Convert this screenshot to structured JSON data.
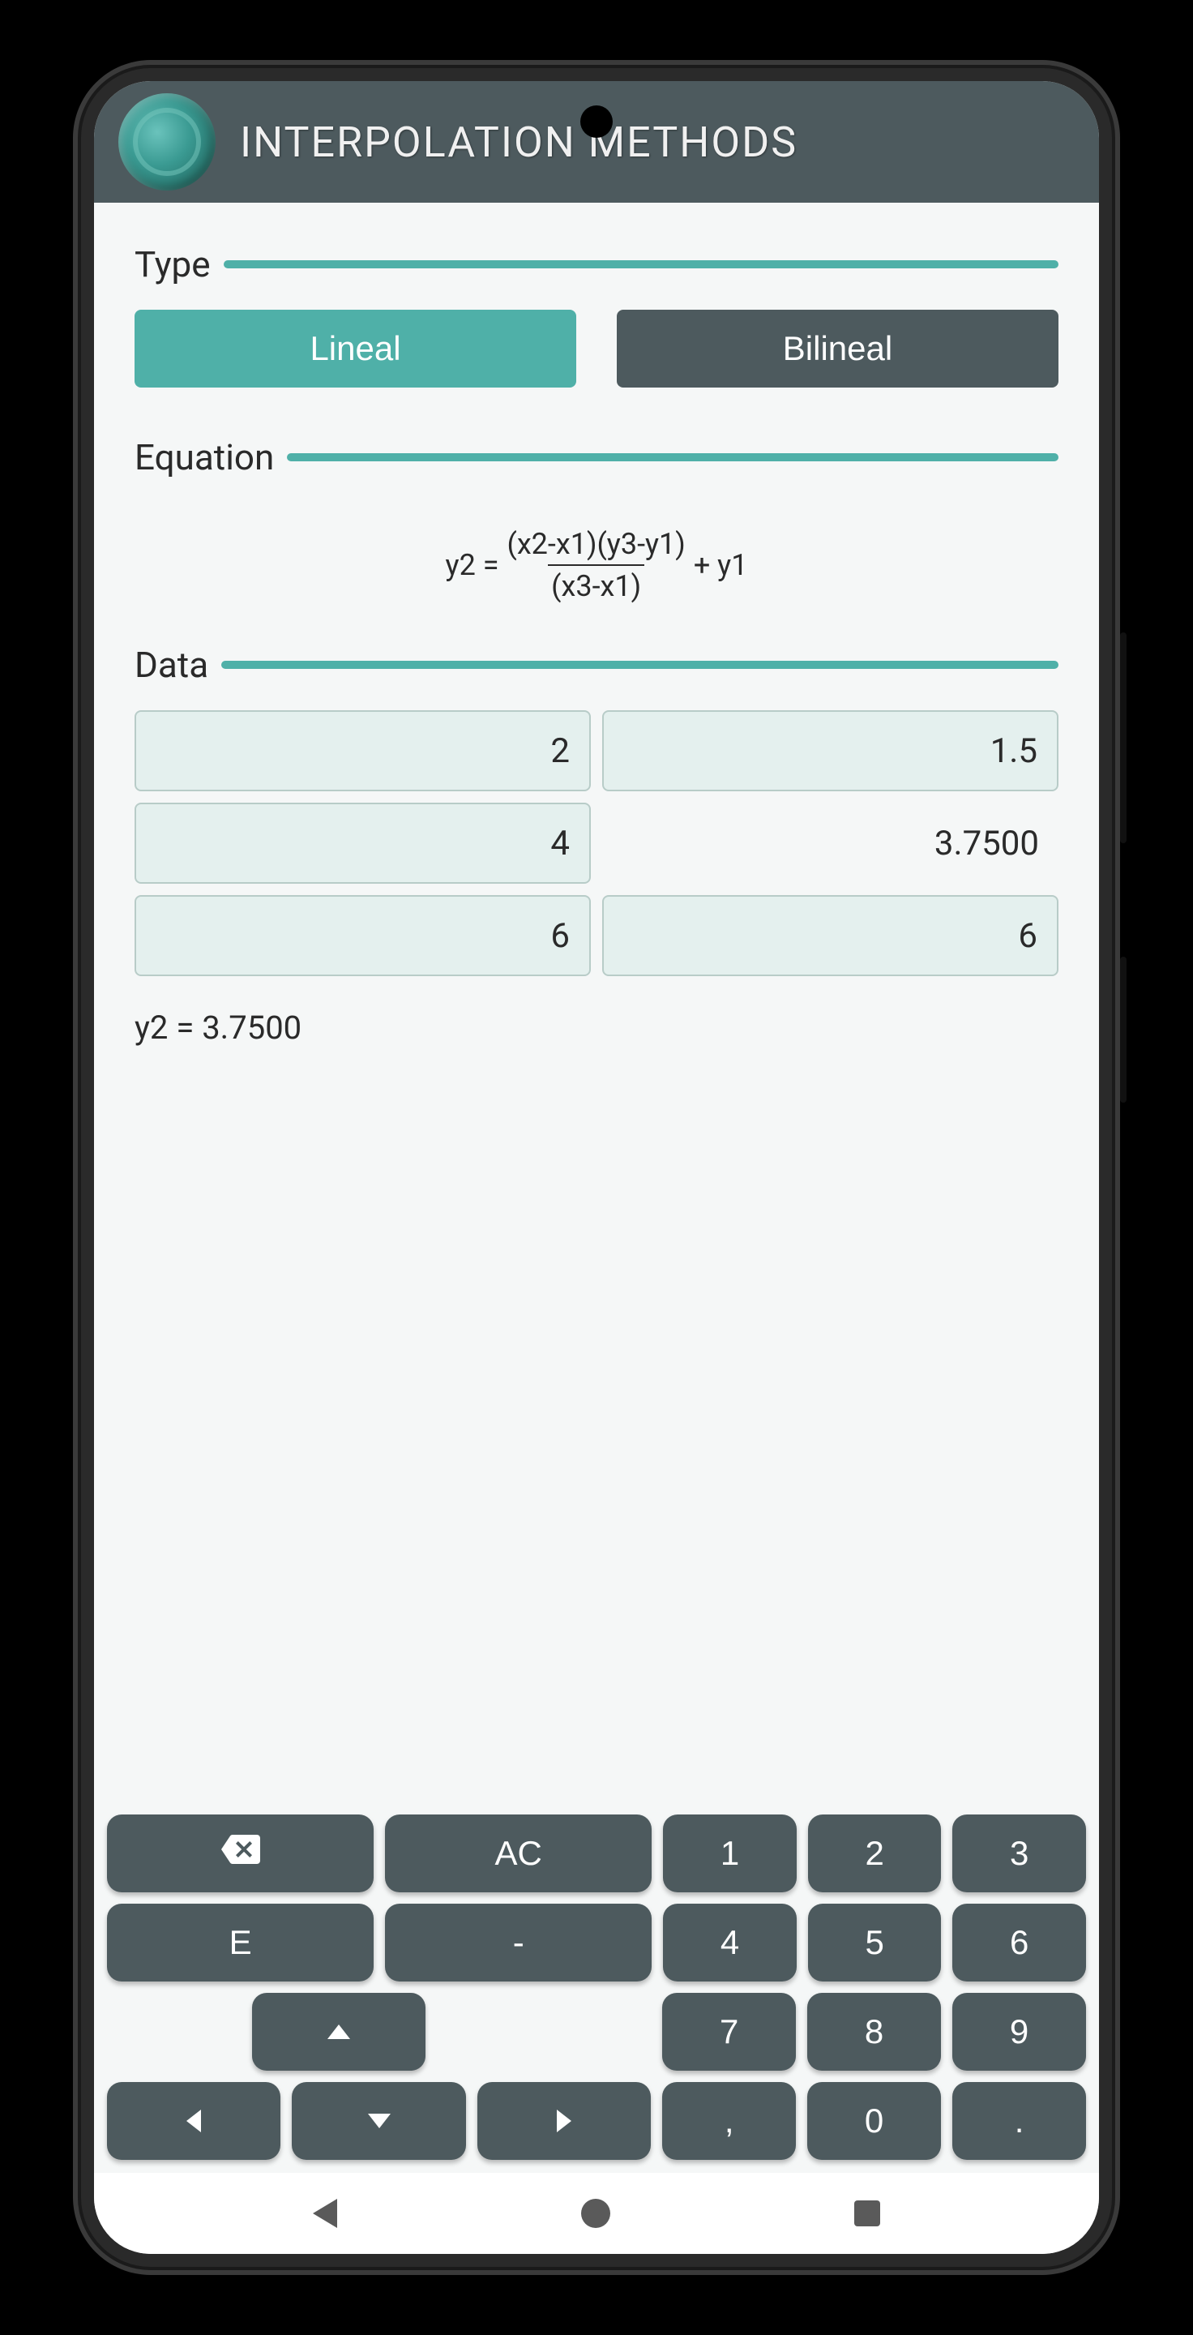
{
  "header": {
    "title": "INTERPOLATION METHODS"
  },
  "sections": {
    "type": {
      "label": "Type"
    },
    "equation": {
      "label": "Equation"
    },
    "data": {
      "label": "Data"
    }
  },
  "type_buttons": {
    "lineal": "Lineal",
    "bilineal": "Bilineal",
    "active": "lineal"
  },
  "equation": {
    "lhs": "y2 = ",
    "numerator": "(x2-x1)(y3-y1)",
    "denominator": "(x3-x1)",
    "tail": " + y1"
  },
  "data_grid": {
    "x1": "2",
    "y1": "1.5",
    "x2": "4",
    "y2_result": "3.7500",
    "x3": "6",
    "y3": "6"
  },
  "result_text": "y2 = 3.7500",
  "keyboard": {
    "row1": {
      "backspace": "⌫",
      "ac": "AC",
      "n1": "1",
      "n2": "2",
      "n3": "3"
    },
    "row2": {
      "e": "E",
      "minus": "-",
      "n4": "4",
      "n5": "5",
      "n6": "6"
    },
    "row3": {
      "up": "▲",
      "n7": "7",
      "n8": "8",
      "n9": "9"
    },
    "row4": {
      "left": "◀",
      "down": "▼",
      "right": "▶",
      "comma": ",",
      "n0": "0",
      "dot": "."
    }
  }
}
